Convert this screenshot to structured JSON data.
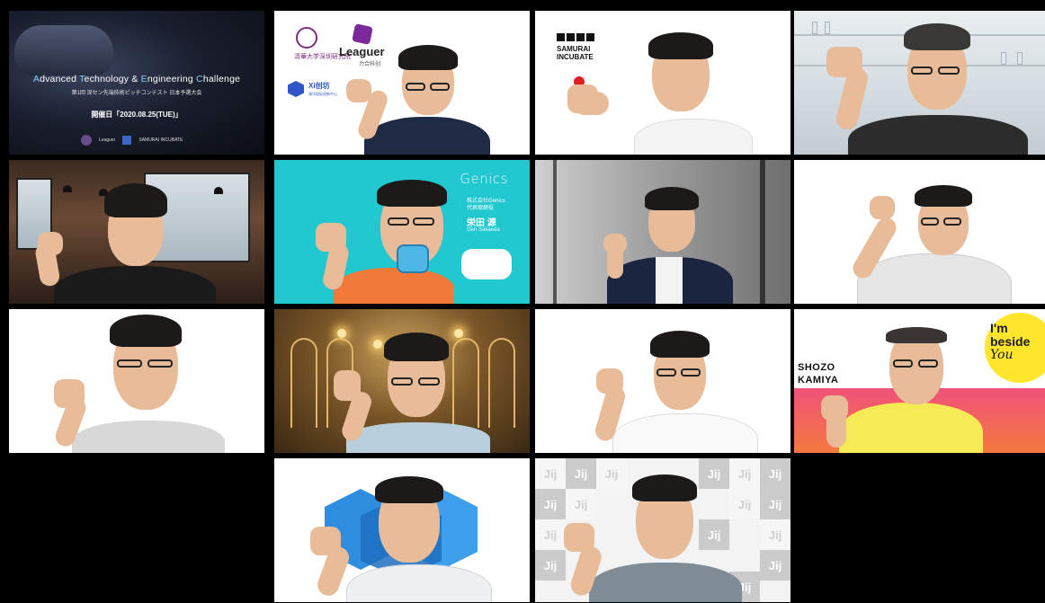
{
  "window": {
    "app": "video-conference gallery view"
  },
  "banner": {
    "title_prefix_A": "A",
    "title_w1": "dvanced ",
    "title_prefix_T": "T",
    "title_w2": "echnology & ",
    "title_prefix_E": "E",
    "title_w3": "ngineering ",
    "title_prefix_C": "C",
    "title_w4": "hallenge",
    "subtitle": "第1回 深セン先端技術ピッチコンテスト 日本予選大会",
    "date": "開催日「2020.08.25(TUE)」",
    "logo_leaguer": "Leaguer",
    "logo_samurai": "SAMURAI INCUBATE"
  },
  "tile1": {
    "university": "清華大学深圳研究院",
    "leaguer": "Leaguer",
    "leaguer_sub": "力合科创",
    "incubator": "Xi创坊",
    "incubator_sub": "清华国际创新中心"
  },
  "tile2": {
    "samurai_line1": "SAMURAI",
    "samurai_line2": "INCUBATE"
  },
  "tile5": {
    "logo": "Genics",
    "company_line1": "株式会社Genics",
    "company_line2": "代表取締役",
    "name": "栄田 源",
    "name_roman": "Gen Sakaeda"
  },
  "tile11": {
    "name_line1": "SHOZO",
    "name_line2": "KAMIYA",
    "tagline_1": "I'm",
    "tagline_2": "beside",
    "tagline_3": "You"
  },
  "tile13": {
    "jij_text": "Jij"
  },
  "colors": {
    "background": "#000000",
    "genics_teal": "#22c8cf",
    "beside_yellow": "#ffe62c",
    "cube_blue": "#2f8de0"
  }
}
